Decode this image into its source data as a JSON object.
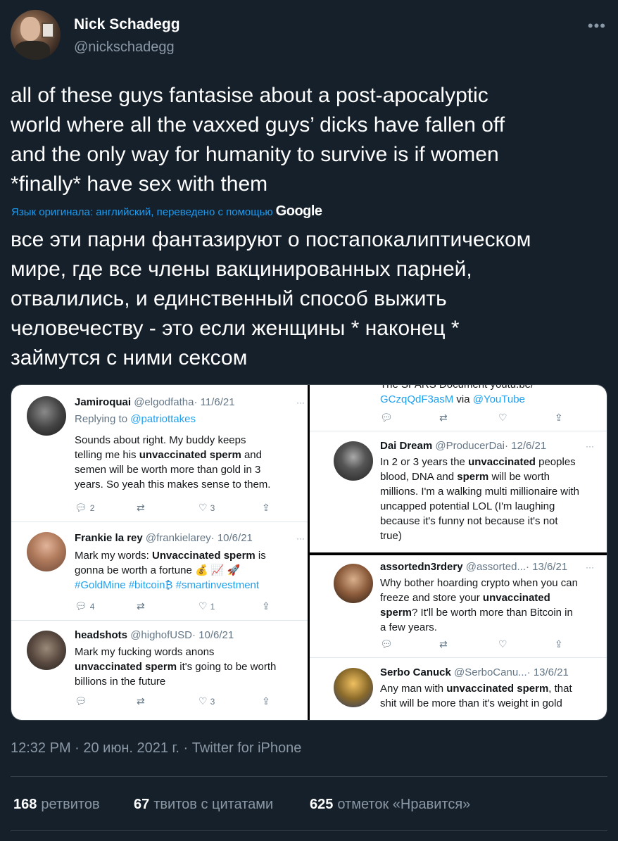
{
  "author": {
    "name": "Nick Schadegg",
    "handle": "@nickschadegg"
  },
  "menu_icon": "more-horizontal-icon",
  "tweet": {
    "lines": [
      "all of these guys fantasise about a post-apocalyptic",
      "world where all the vaxxed guys’ dicks have fallen off",
      "and the only way for humanity to survive is if women",
      "*finally* have sex with them"
    ],
    "translated_note": "Язык оригинала: английский, переведено с помощью",
    "translated_brand": "Google",
    "translation_lines": [
      "все эти парни фантазируют о постапокалиптическом",
      "мире, где все члены вакцинированных парней,",
      "отвалились, и единственный способ выжить",
      "человечеству - это если женщины * наконец *",
      "займутся с ними сексом"
    ]
  },
  "media": {
    "left": [
      {
        "name": "Jamiroquai",
        "handle": "@elgodfatha",
        "date": "· 11/6/21",
        "replying_prefix": "Replying to",
        "replying_to": "@patriottakes",
        "lines": [
          "Sounds about right. My buddy keeps",
          "telling me his ",
          "semen will be worth more than gold in 3",
          "years. So yeah this makes sense to them."
        ],
        "bold": "unvaccinated sperm",
        "bold_suffix": " and",
        "counts": {
          "reply": "2",
          "like": "3"
        }
      },
      {
        "name": "Frankie la rey",
        "handle": "@frankielarey",
        "date": "· 10/6/21",
        "line1_prefix": "Mark my words: ",
        "line1_bold": "Unvaccinated sperm",
        "line1_suffix": " is",
        "line2": "gonna be worth a fortune 💰 📈 🚀",
        "line3": "#GoldMine #bitcoin₿ #smartinvestment",
        "counts": {
          "reply": "4",
          "like": "1"
        }
      },
      {
        "name": "headshots",
        "handle": "@highofUSD",
        "date": "· 10/6/21",
        "line1": "Mark my fucking words anons",
        "line2_bold": "unvaccinated sperm",
        "line2_suffix": " it's going to be worth",
        "line3": "billions in the future",
        "counts": {
          "reply": "",
          "like": "3"
        }
      }
    ],
    "top_right": {
      "cut_line": "The SPARS Document youtu.be/",
      "link_line": "GCzqQdF3asM",
      "via": " via ",
      "via_link": "@YouTube",
      "name": "Dai Dream",
      "handle": "@ProducerDai",
      "date": "· 12/6/21",
      "l1_prefix": "In 2 or 3 years the ",
      "l1_bold": "unvaccinated",
      "l1_suffix": "  peoples",
      "l2_prefix": "blood, DNA and ",
      "l2_bold": "sperm",
      "l2_suffix": " will be worth",
      "l3": "millions. I'm a walking multi millionaire with",
      "l4": "uncapped potential LOL (I'm laughing",
      "l5": "because it's funny not because it's not",
      "l6": "true)"
    },
    "bottom_right": [
      {
        "name": "assortedn3rdery",
        "handle": "@assorted...",
        "date": "· 13/6/21",
        "l1": "Why bother hoarding crypto when you can",
        "l2_prefix": "freeze and store your ",
        "l2_bold": "unvaccinated",
        "l3_bold": "sperm",
        "l3_suffix": "? It'll be worth more than Bitcoin in",
        "l4": "a few years."
      },
      {
        "name": "Serbo Canuck",
        "handle": "@SerboCanu...",
        "date": "· 13/6/21",
        "l1_prefix": "Any man with ",
        "l1_bold": "unvaccinated sperm",
        "l1_suffix": ", that",
        "l2": "shit will be more than it's weight in gold"
      }
    ]
  },
  "meta": {
    "timestamp": "12:32 PM · 20 июн. 2021 г. · Twitter for iPhone"
  },
  "stats": {
    "retweets": {
      "count": "168",
      "label": "ретвитов"
    },
    "quotes": {
      "count": "67",
      "label": "твитов с цитатами"
    },
    "likes": {
      "count": "625",
      "label": "отметок «Нравится»"
    }
  }
}
